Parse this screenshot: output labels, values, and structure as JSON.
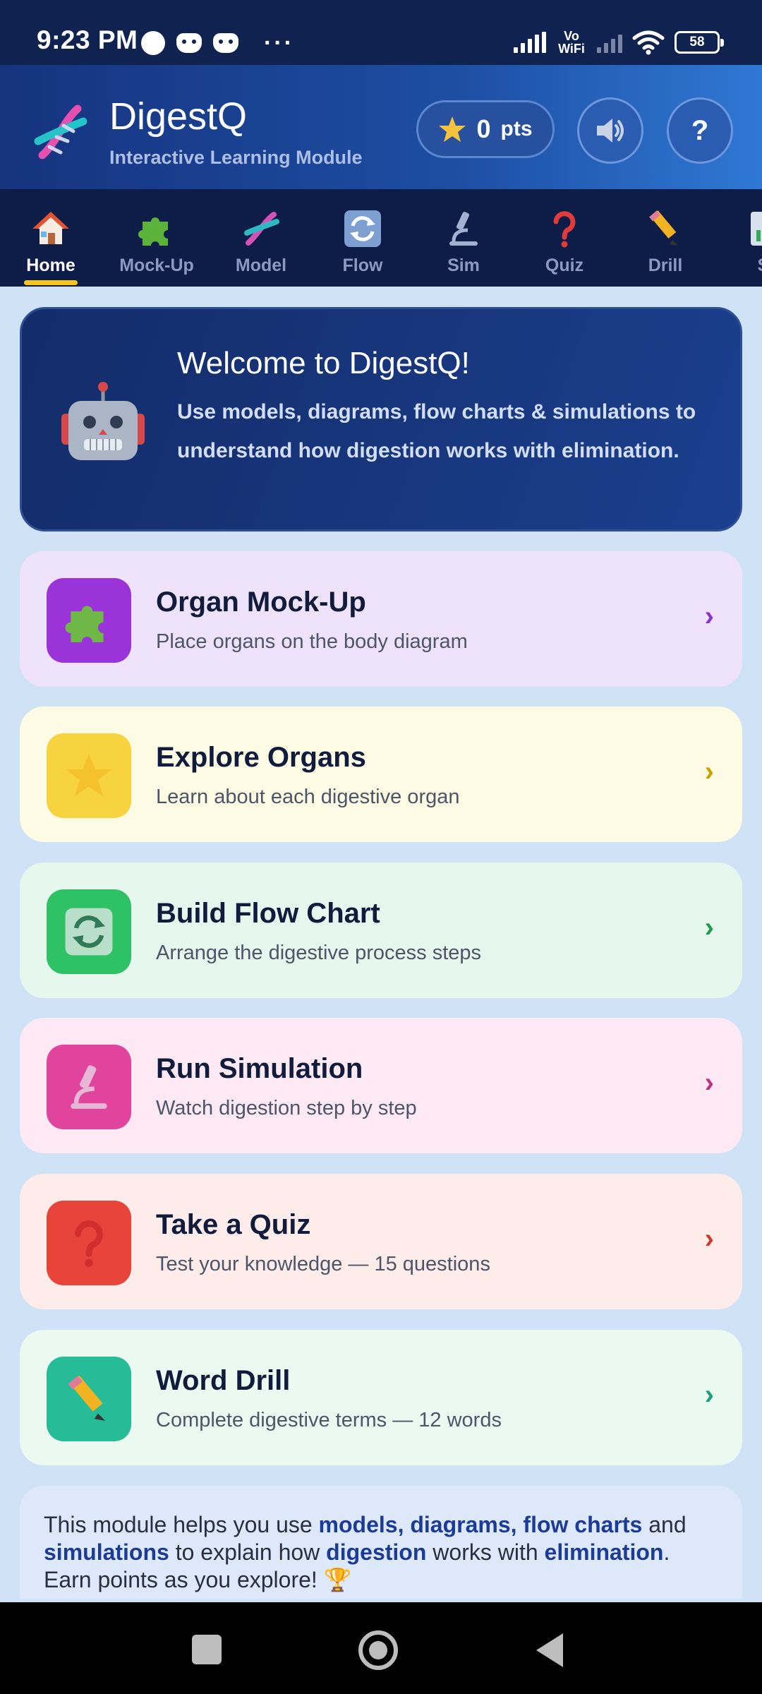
{
  "status_bar": {
    "time": "9:23 PM",
    "vo_wifi": "Vo WiFi",
    "battery": "58",
    "more": "···"
  },
  "header": {
    "title": "DigestQ",
    "subtitle": "Interactive Learning Module",
    "points_value": "0",
    "points_label": "pts",
    "help_label": "?"
  },
  "nav": {
    "items": [
      {
        "label": "Home",
        "icon": "house-icon",
        "active": true
      },
      {
        "label": "Mock-Up",
        "icon": "puzzle-icon"
      },
      {
        "label": "Model",
        "icon": "dna-icon"
      },
      {
        "label": "Flow",
        "icon": "cycle-arrows-icon"
      },
      {
        "label": "Sim",
        "icon": "microscope-icon"
      },
      {
        "label": "Quiz",
        "icon": "question-icon"
      },
      {
        "label": "Drill",
        "icon": "pencil-icon"
      },
      {
        "label": "St",
        "icon": "chart-icon"
      }
    ]
  },
  "welcome": {
    "title": "Welcome to DigestQ!",
    "body": "Use models, diagrams, flow charts & simulations to understand how digestion works with elimination.",
    "icon": "robot-icon"
  },
  "cards": [
    {
      "title": "Organ Mock-Up",
      "subtitle": "Place organs on the body diagram",
      "icon": "puzzle-icon",
      "bg": "#efe3fc",
      "icon_bg": "#9a34d8",
      "chevron_color": "#8e2fd0"
    },
    {
      "title": "Explore Organs",
      "subtitle": "Learn about each digestive organ",
      "icon": "star-icon",
      "bg": "#fdfbe3",
      "icon_bg": "#f8d340",
      "chevron_color": "#c9a200"
    },
    {
      "title": "Build Flow Chart",
      "subtitle": "Arrange the digestive process steps",
      "icon": "cycle-arrows-icon",
      "bg": "#e6f7ee",
      "icon_bg": "#2fc166",
      "chevron_color": "#1e9b4f"
    },
    {
      "title": "Run Simulation",
      "subtitle": "Watch digestion step by step",
      "icon": "microscope-icon",
      "bg": "#fde9f4",
      "icon_bg": "#e0449c",
      "chevron_color": "#c02d85"
    },
    {
      "title": "Take a Quiz",
      "subtitle": "Test your knowledge — 15 questions",
      "icon": "question-icon",
      "bg": "#fdecea",
      "icon_bg": "#e9443a",
      "chevron_color": "#d2392f"
    },
    {
      "title": "Word Drill",
      "subtitle": "Complete digestive terms — 12 words",
      "icon": "pencil-icon",
      "bg": "#eafaf1",
      "icon_bg": "#27bc98",
      "chevron_color": "#1aa07f"
    }
  ],
  "chevron": "›",
  "info": {
    "p1": "This module helps you use ",
    "b1": "models, diagrams, flow charts",
    "p2": " and ",
    "b2": "simulations",
    "p3": " to explain how ",
    "b3": "digestion",
    "p4": " works with ",
    "b4": "elimination",
    "p5": ". Earn points as you explore! ",
    "trophy": "🏆"
  }
}
